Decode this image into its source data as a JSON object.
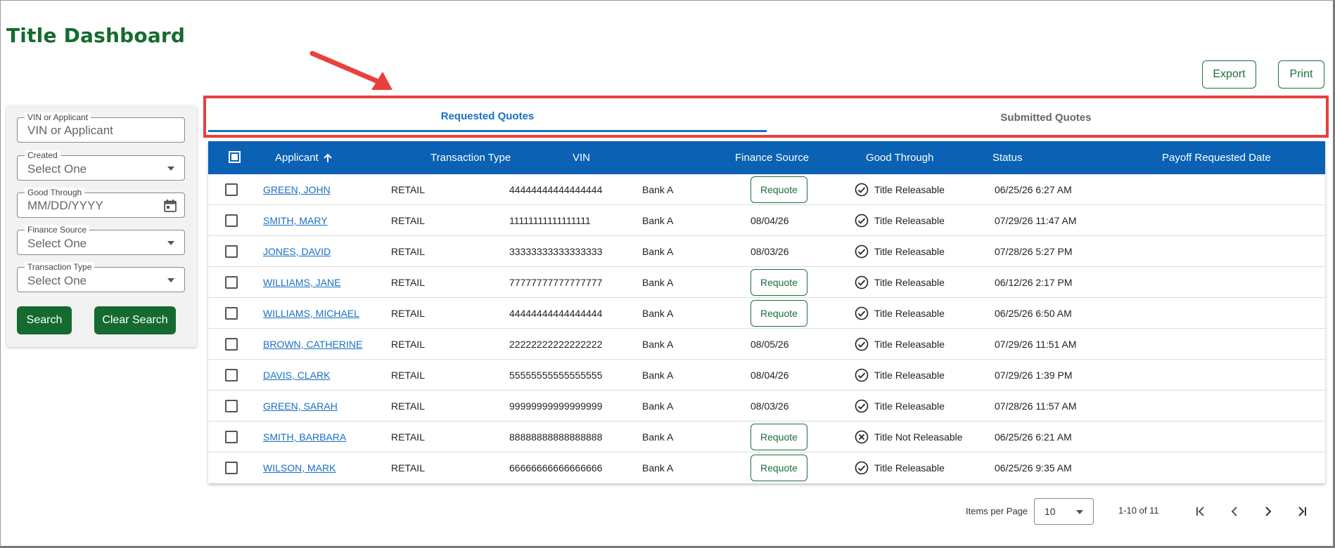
{
  "page_title": "Title Dashboard",
  "actions": {
    "export_label": "Export",
    "print_label": "Print"
  },
  "filters": {
    "vin": {
      "label": "VIN or Applicant",
      "placeholder": "VIN or Applicant"
    },
    "created": {
      "label": "Created",
      "value": "Select One"
    },
    "good_through": {
      "label": "Good Through",
      "placeholder": "MM/DD/YYYY"
    },
    "finance_source": {
      "label": "Finance Source",
      "value": "Select One"
    },
    "transaction_type": {
      "label": "Transaction Type",
      "value": "Select One"
    },
    "search_label": "Search",
    "clear_label": "Clear Search"
  },
  "tabs": [
    {
      "label": "Requested Quotes",
      "active": true
    },
    {
      "label": "Submitted Quotes",
      "active": false
    }
  ],
  "table": {
    "columns": {
      "applicant": "Applicant",
      "transaction_type": "Transaction Type",
      "vin": "VIN",
      "finance_source": "Finance Source",
      "good_through": "Good Through",
      "status": "Status",
      "payoff_date": "Payoff Requested Date"
    },
    "sort": {
      "column": "applicant",
      "direction": "ascending"
    },
    "requote_label": "Requote",
    "rows": [
      {
        "applicant": "GREEN, JOHN",
        "type": "RETAIL",
        "vin": "44444444444444444",
        "finance": "Bank A",
        "good_through": null,
        "status": "Title Releasable",
        "releasable": true,
        "payoff": "06/25/26 6:27 AM"
      },
      {
        "applicant": "SMITH, MARY",
        "type": "RETAIL",
        "vin": "11111111111111111",
        "finance": "Bank A",
        "good_through": "08/04/26",
        "status": "Title Releasable",
        "releasable": true,
        "payoff": "07/29/26 11:47 AM"
      },
      {
        "applicant": "JONES, DAVID",
        "type": "RETAIL",
        "vin": "33333333333333333",
        "finance": "Bank A",
        "good_through": "08/03/26",
        "status": "Title Releasable",
        "releasable": true,
        "payoff": "07/28/26 5:27 PM"
      },
      {
        "applicant": "WILLIAMS, JANE",
        "type": "RETAIL",
        "vin": "77777777777777777",
        "finance": "Bank A",
        "good_through": null,
        "status": "Title Releasable",
        "releasable": true,
        "payoff": "06/12/26 2:17 PM"
      },
      {
        "applicant": "WILLIAMS, MICHAEL",
        "type": "RETAIL",
        "vin": "44444444444444444",
        "finance": "Bank A",
        "good_through": null,
        "status": "Title Releasable",
        "releasable": true,
        "payoff": "06/25/26 6:50 AM"
      },
      {
        "applicant": "BROWN, CATHERINE",
        "type": "RETAIL",
        "vin": "22222222222222222",
        "finance": "Bank A",
        "good_through": "08/05/26",
        "status": "Title Releasable",
        "releasable": true,
        "payoff": "07/29/26 11:51 AM"
      },
      {
        "applicant": "DAVIS, CLARK",
        "type": "RETAIL",
        "vin": "55555555555555555",
        "finance": "Bank A",
        "good_through": "08/04/26",
        "status": "Title Releasable",
        "releasable": true,
        "payoff": "07/29/26 1:39 PM"
      },
      {
        "applicant": "GREEN, SARAH",
        "type": "RETAIL",
        "vin": "99999999999999999",
        "finance": "Bank A",
        "good_through": "08/03/26",
        "status": "Title Releasable",
        "releasable": true,
        "payoff": "07/28/26 11:57 AM"
      },
      {
        "applicant": "SMITH, BARBARA",
        "type": "RETAIL",
        "vin": "88888888888888888",
        "finance": "Bank A",
        "good_through": null,
        "status": "Title Not Releasable",
        "releasable": false,
        "payoff": "06/25/26 6:21 AM"
      },
      {
        "applicant": "WILSON, MARK",
        "type": "RETAIL",
        "vin": "66666666666666666",
        "finance": "Bank A",
        "good_through": null,
        "status": "Title Releasable",
        "releasable": true,
        "payoff": "06/25/26 9:35 AM"
      }
    ]
  },
  "pagination": {
    "items_per_page_label": "Items per Page",
    "items_per_page": "10",
    "range": "1-10 of 11"
  },
  "icons": {
    "sort": "arrow-up-icon",
    "releasable": "check-circle-icon",
    "not_releasable": "x-circle-icon",
    "date": "calendar-icon",
    "first": "first-page-icon",
    "prev": "chevron-left-icon",
    "next": "chevron-right-icon",
    "last": "last-page-icon"
  },
  "colors": {
    "brand_green": "#156b2f",
    "header_blue": "#0b61b3",
    "link_blue": "#1a6fc4",
    "highlight_red": "#e8403f"
  }
}
